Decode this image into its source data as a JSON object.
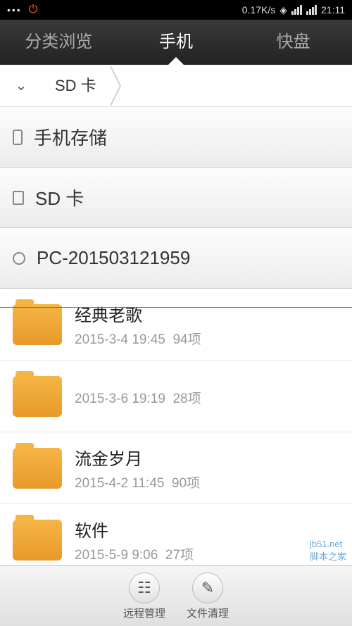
{
  "statusbar": {
    "speed": "0.17K/s",
    "time": "21:11"
  },
  "tabs": {
    "items": [
      "分类浏览",
      "手机",
      "快盘"
    ],
    "activeIndex": 1
  },
  "breadcrumb": {
    "path": [
      "SD 卡"
    ]
  },
  "sections": [
    {
      "icon": "phone",
      "label": "手机存储"
    },
    {
      "icon": "sd",
      "label": "SD 卡"
    },
    {
      "icon": "wifi",
      "label": "PC-201503121959"
    }
  ],
  "folders": [
    {
      "name": "经典老歌",
      "date": "2015-3-4 19:45",
      "count": "94项"
    },
    {
      "name": "",
      "date": "2015-3-6 19:19",
      "count": "28项"
    },
    {
      "name": "流金岁月",
      "date": "2015-4-2 11:45",
      "count": "90项"
    },
    {
      "name": "软件",
      "date": "2015-5-9 9:06",
      "count": "27项"
    }
  ],
  "bottombar": {
    "items": [
      {
        "label": "远程管理"
      },
      {
        "label": "文件清理"
      }
    ]
  },
  "watermark": {
    "line1": "jb51.net",
    "line2": "脚本之家"
  }
}
